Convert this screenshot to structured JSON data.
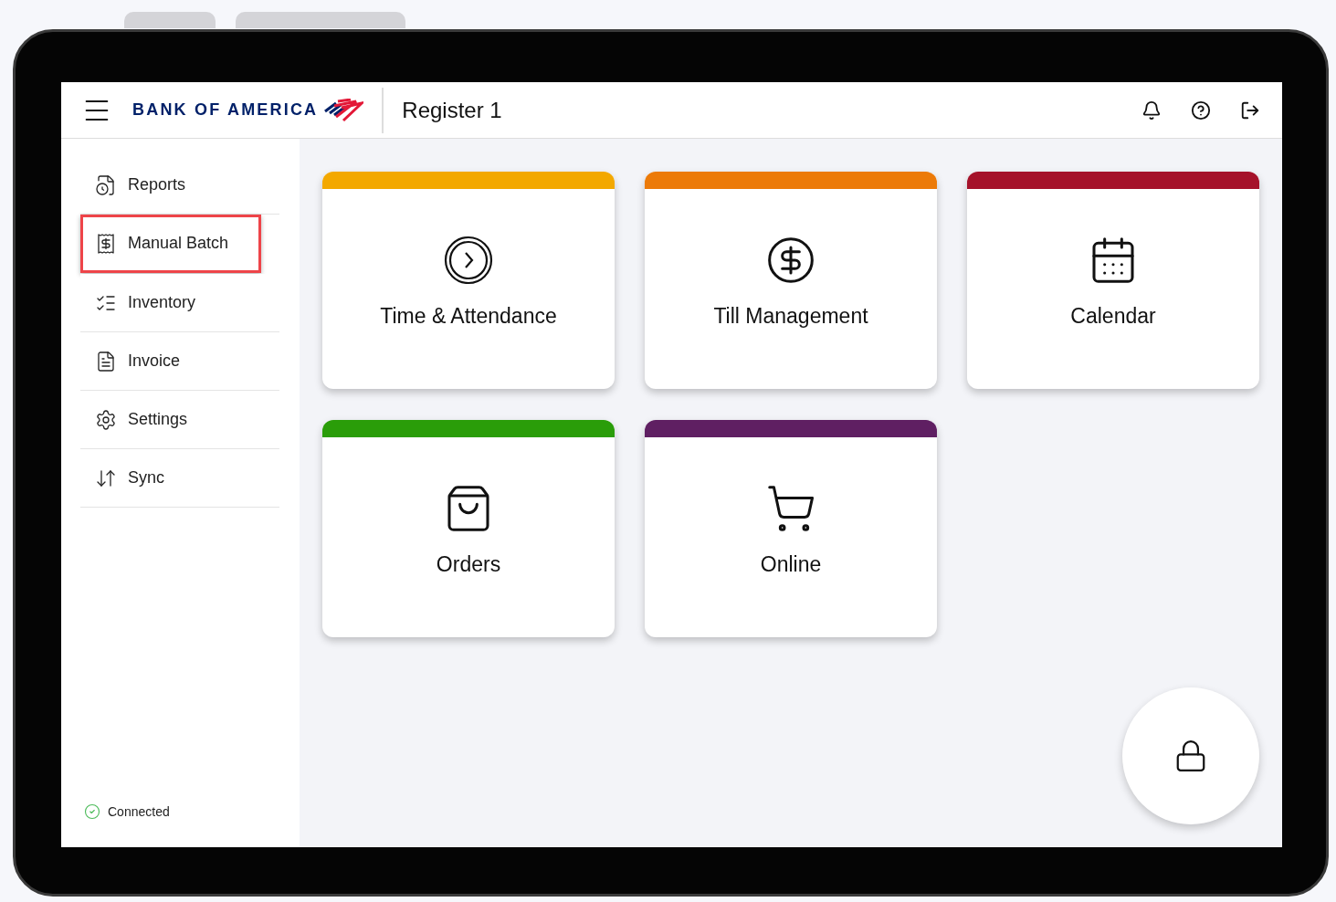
{
  "header": {
    "brand": "BANK OF AMERICA",
    "title": "Register 1"
  },
  "sidebar": {
    "items": [
      {
        "label": "Reports",
        "selected": false
      },
      {
        "label": "Manual Batch",
        "selected": true
      },
      {
        "label": "Inventory",
        "selected": false
      },
      {
        "label": "Invoice",
        "selected": false
      },
      {
        "label": "Settings",
        "selected": false
      },
      {
        "label": "Sync",
        "selected": false
      }
    ],
    "status": {
      "label": "Connected",
      "connected": true
    }
  },
  "tiles": [
    {
      "label": "Time & Attendance",
      "color": "#f3a800"
    },
    {
      "label": "Till Management",
      "color": "#ec7a08"
    },
    {
      "label": "Calendar",
      "color": "#a5122a"
    },
    {
      "label": "Orders",
      "color": "#2a9d09"
    },
    {
      "label": "Online",
      "color": "#5f1f62"
    }
  ]
}
